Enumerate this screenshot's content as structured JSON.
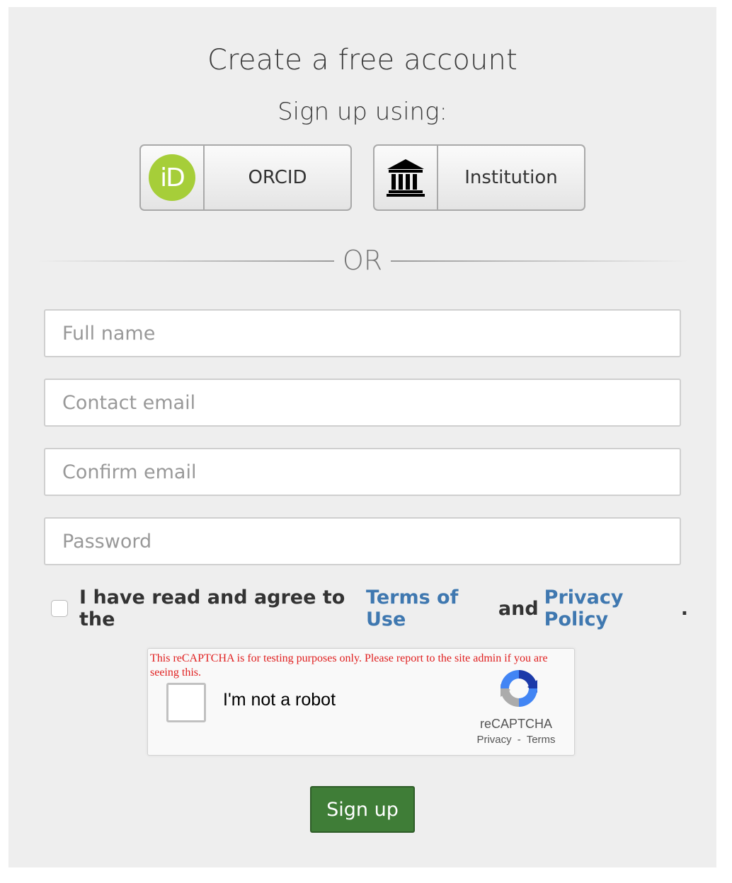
{
  "page": {
    "title": "Create a free account",
    "subtitle": "Sign up using:"
  },
  "sso": {
    "orcid_label": "ORCID",
    "orcid_icon_text": "iD",
    "institution_label": "Institution"
  },
  "divider": {
    "text": "OR"
  },
  "form": {
    "full_name_placeholder": "Full name",
    "contact_email_placeholder": "Contact email",
    "confirm_email_placeholder": "Confirm email",
    "password_placeholder": "Password"
  },
  "agreement": {
    "prefix": "I have read and agree to the",
    "terms_link": "Terms of Use",
    "conjunction": "and",
    "privacy_link": "Privacy Policy",
    "suffix": "."
  },
  "recaptcha": {
    "warning": "This reCAPTCHA is for testing purposes only. Please report to the site admin if you are seeing this.",
    "label": "I'm not a robot",
    "brand": "reCAPTCHA",
    "privacy": "Privacy",
    "separator": "-",
    "terms": "Terms"
  },
  "submit": {
    "label": "Sign up"
  },
  "colors": {
    "orcid_green": "#a6ce39",
    "link_blue": "#3f78b0",
    "signup_green": "#3f7d37",
    "warning_red": "#e02020"
  }
}
